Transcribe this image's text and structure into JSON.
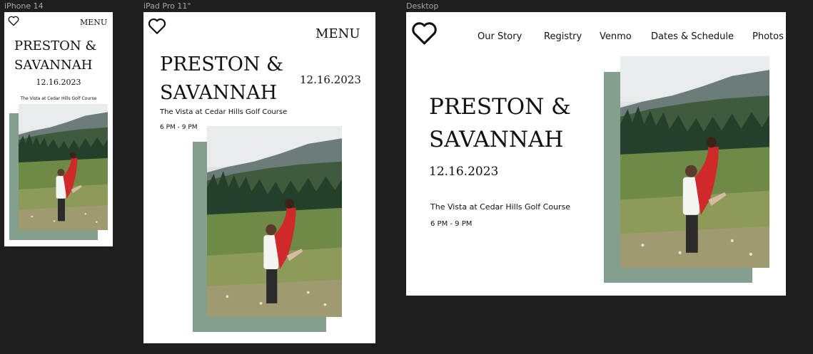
{
  "frames": {
    "phone": {
      "label": "iPhone 14"
    },
    "tablet": {
      "label": "iPad Pro 11\""
    },
    "desktop": {
      "label": "Desktop"
    }
  },
  "site": {
    "couple_line1": "PRESTON &",
    "couple_line2": "SAVANNAH",
    "date": "12.16.2023",
    "venue": "The Vista at Cedar Hills Golf Course",
    "time": "6 PM - 9 PM",
    "menu_label": "MENU"
  },
  "nav": {
    "items": [
      "Our Story",
      "Registry",
      "Venmo",
      "Dates & Schedule",
      "Photos"
    ]
  },
  "colors": {
    "accent_green": "#839f8e",
    "canvas_bg": "#1e1e1e"
  },
  "icons": {
    "logo": "heart-outline-icon"
  }
}
